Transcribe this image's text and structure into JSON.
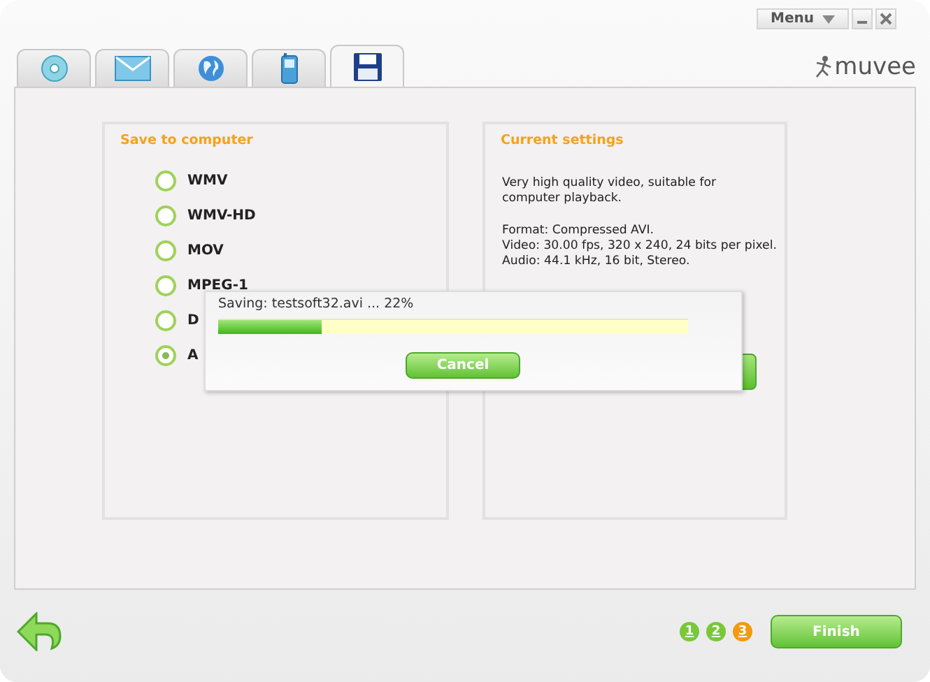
{
  "title_bar": {
    "menu": "Menu",
    "logo": "muvee"
  },
  "tabs": [
    {
      "kind": "disc",
      "selected": false
    },
    {
      "kind": "envelope",
      "selected": false
    },
    {
      "kind": "globe",
      "selected": false
    },
    {
      "kind": "phone",
      "selected": false
    },
    {
      "kind": "floppy",
      "selected": true
    }
  ],
  "save_panel": {
    "title": "Save to computer",
    "options": [
      {
        "label": "WMV",
        "selected": false
      },
      {
        "label": "WMV-HD",
        "selected": false
      },
      {
        "label": "MOV",
        "selected": false
      },
      {
        "label": "MPEG-1",
        "selected": false
      },
      {
        "label": "D",
        "selected": false
      },
      {
        "label": "A",
        "selected": true
      }
    ]
  },
  "settings_panel": {
    "title": "Current settings",
    "description": "Very high quality video, suitable for computer playback.",
    "details": [
      "Format: Compressed AVI.",
      "Video: 30.00 fps, 320 x 240, 24 bits per pixel.",
      "Audio:  44.1 kHz, 16 bit, Stereo."
    ]
  },
  "progress_dialog": {
    "status": "Saving: testsoft32.avi ... 22%",
    "level": 0.22,
    "button": "Cancel"
  },
  "footer": {
    "steps": [
      {
        "label": "1",
        "selected": false
      },
      {
        "label": "2",
        "selected": false
      },
      {
        "label": "3",
        "selected": true
      }
    ],
    "finish": "Finish"
  }
}
